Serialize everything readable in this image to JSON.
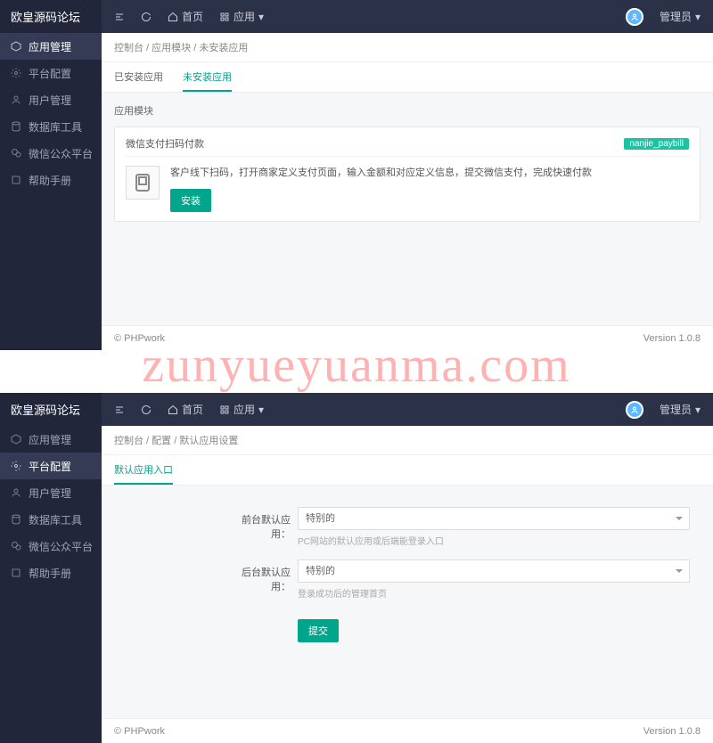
{
  "brand": "欧皇源码论坛",
  "topbar": {
    "home": "首页",
    "app": "应用",
    "user": "管理员"
  },
  "sidebar": {
    "items": [
      {
        "label": "应用管理",
        "icon": "cube"
      },
      {
        "label": "平台配置",
        "icon": "gear"
      },
      {
        "label": "用户管理",
        "icon": "user"
      },
      {
        "label": "数据库工具",
        "icon": "db"
      },
      {
        "label": "微信公众平台",
        "icon": "wechat"
      },
      {
        "label": "帮助手册",
        "icon": "book"
      }
    ]
  },
  "panel1": {
    "crumb": {
      "a": "控制台",
      "b": "应用模块",
      "c": "未安装应用"
    },
    "tabs": {
      "installed": "已安装应用",
      "uninstalled": "未安装应用"
    },
    "section": "应用模块",
    "module": {
      "title": "微信支付扫码付款",
      "tag": "nanjie_paybill",
      "desc": "客户线下扫码，打开商家定义支付页面，输入金额和对应定义信息，提交微信支付，完成快速付款",
      "btn": "安装"
    }
  },
  "panel2": {
    "crumb": {
      "a": "控制台",
      "b": "配置",
      "c": "默认应用设置"
    },
    "tab": "默认应用入口",
    "form": {
      "front_label": "前台默认应用：",
      "front_value": "特别的",
      "front_hint": "PC网站的默认应用或后端能登录入口",
      "back_label": "后台默认应用：",
      "back_value": "特别的",
      "back_hint": "登录成功后的管理首页",
      "submit": "提交"
    }
  },
  "footer": {
    "left": "© PHPwork",
    "right": "Version 1.0.8"
  },
  "watermark": "zunyueyuanma.com"
}
